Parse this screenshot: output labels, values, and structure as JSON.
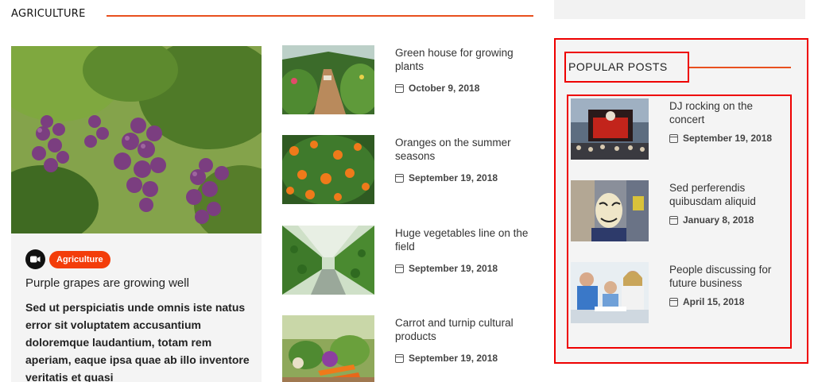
{
  "section": {
    "title": "AGRICULTURE"
  },
  "featured": {
    "category": "Agriculture",
    "title": "Purple grapes are growing well",
    "excerpt": "Sed ut perspiciatis unde omnis iste natus error sit voluptatem accusantium doloremque laudantium, totam rem aperiam, eaque ipsa quae ab illo inventore veritatis et quasi",
    "icon": "video-camera-icon"
  },
  "posts": [
    {
      "title": "Green house for growing plants",
      "date": "October 9, 2018"
    },
    {
      "title": "Oranges on the summer seasons",
      "date": "September 19, 2018"
    },
    {
      "title": "Huge vegetables line on the field",
      "date": "September 19, 2018"
    },
    {
      "title": "Carrot and turnip cultural products",
      "date": "September 19, 2018"
    }
  ],
  "sidebar": {
    "title": "POPULAR POSTS",
    "posts": [
      {
        "title": "DJ rocking on the concert",
        "date": "September 19, 2018"
      },
      {
        "title": "Sed perferendis quibusdam aliquid",
        "date": "January 8, 2018"
      },
      {
        "title": "People discussing for future business",
        "date": "April 15, 2018"
      }
    ]
  },
  "colors": {
    "accent": "#e8501e",
    "badge": "#f33d0a",
    "highlight": "#e00000"
  }
}
